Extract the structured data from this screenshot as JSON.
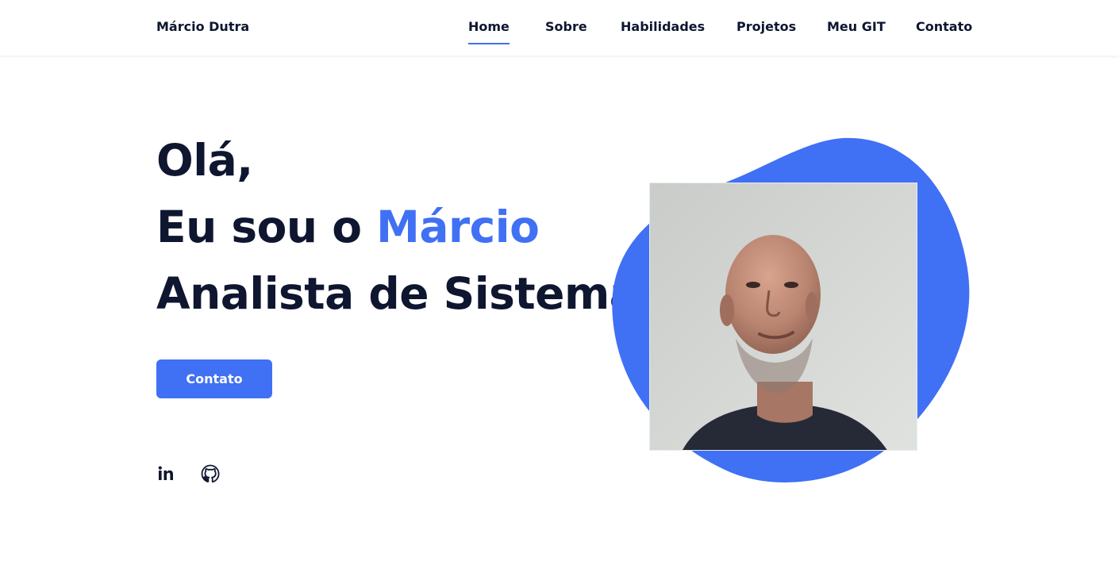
{
  "header": {
    "logo": "Márcio Dutra",
    "nav": [
      {
        "label": "Home",
        "active": true
      },
      {
        "label": "Sobre",
        "active": false
      },
      {
        "label": "Habilidades",
        "active": false
      },
      {
        "label": "Projetos",
        "active": false
      },
      {
        "label": "Meu GIT",
        "active": false
      },
      {
        "label": "Contato",
        "active": false
      }
    ]
  },
  "hero": {
    "greeting": "Olá,",
    "intro_prefix": "Eu sou o ",
    "name": "Márcio",
    "role": "Analista de Sistema",
    "button_label": "Contato"
  },
  "social": [
    {
      "icon": "linkedin-icon"
    },
    {
      "icon": "github-icon"
    }
  ],
  "colors": {
    "accent": "#4070f4",
    "text": "#0e1630",
    "background": "#ffffff"
  }
}
